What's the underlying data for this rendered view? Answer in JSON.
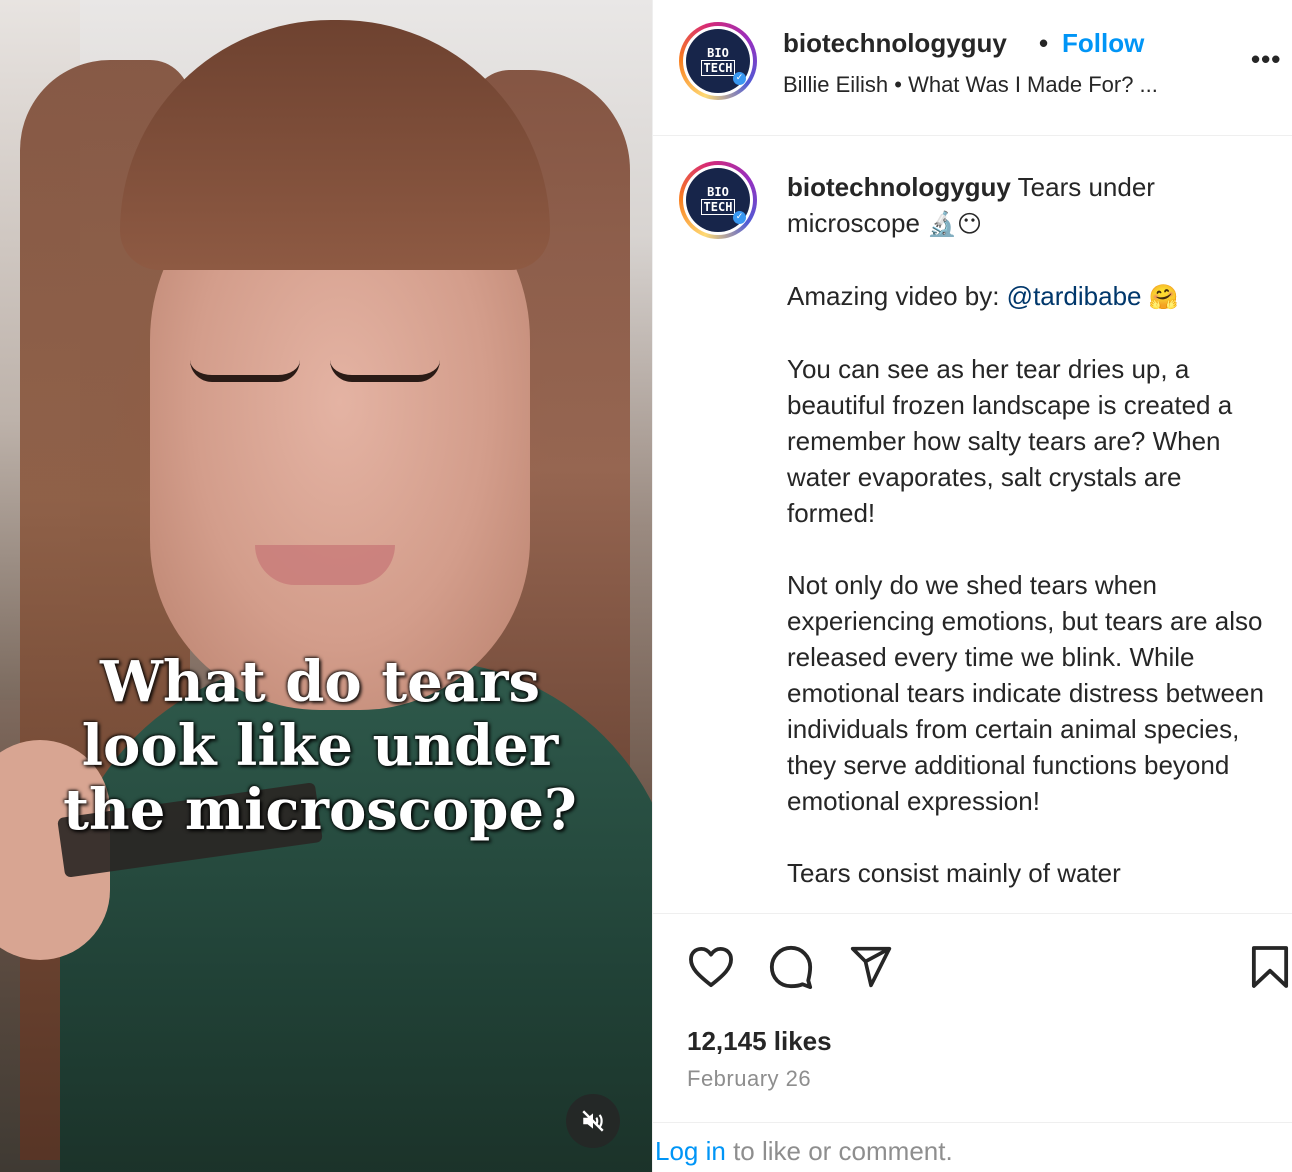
{
  "video": {
    "overlay_line1": "What do tears",
    "overlay_line2": "look like under",
    "overlay_line3": "the microscope?",
    "mute_icon": "speaker-muted-icon"
  },
  "header": {
    "username": "biotechnologyguy",
    "separator": "•",
    "follow_label": "Follow",
    "audio_text": "Billie Eilish • What Was I Made For? ...",
    "more_label": "•••",
    "avatar_text_line1": "BIO",
    "avatar_text_line2": "TECH"
  },
  "caption": {
    "username": "biotechnologyguy",
    "title": " Tears under microscope ",
    "title_emoji": "🔬😶",
    "credit_prefix": "Amazing video by: ",
    "credit_mention": "@tardibabe",
    "credit_emoji": "🤗",
    "paragraph1": "You can see as her tear dries up, a beautiful frozen landscape is created a remember how salty tears are? When water evaporates, salt crystals are formed!",
    "paragraph2": "Not only do we shed tears when experiencing emotions, but tears are also released every time we blink. While emotional tears indicate distress between individuals from certain animal species, they serve additional functions beyond emotional expression!",
    "paragraph3": "Tears consist mainly of water"
  },
  "actions": {
    "like_icon": "heart-icon",
    "comment_icon": "comment-icon",
    "share_icon": "share-icon",
    "save_icon": "bookmark-icon",
    "likes_text": "12,145 likes",
    "date_text": "February 26"
  },
  "footer": {
    "login_link": "Log in",
    "login_rest": " to like or comment."
  },
  "colors": {
    "link_blue": "#0095f6",
    "mention_blue": "#00376b",
    "text_dark": "#262626",
    "text_muted": "#8e8e8e"
  }
}
